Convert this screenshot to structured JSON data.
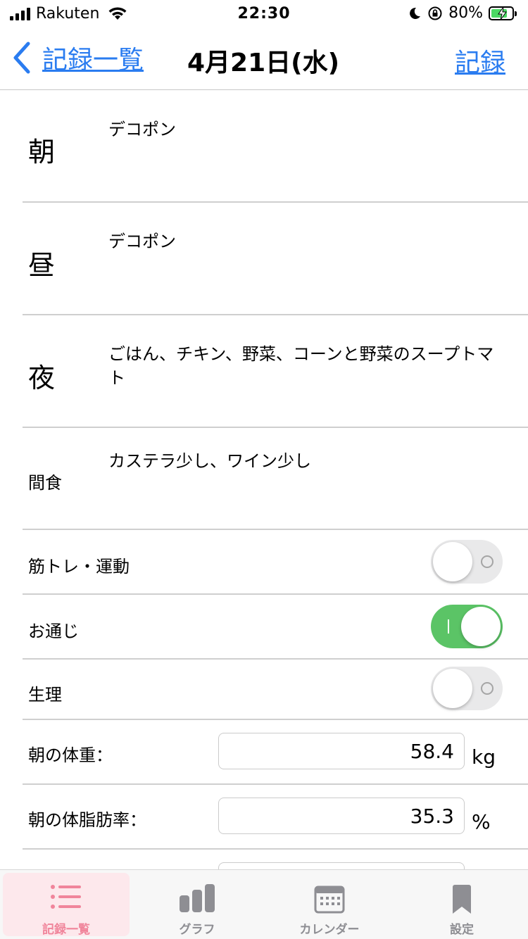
{
  "status_bar": {
    "carrier": "Rakuten",
    "time": "22:30",
    "battery": "80%",
    "battery_level": 0.8
  },
  "nav": {
    "back_label": "記録一覧",
    "title": "4月21日(水)",
    "action_label": "記録"
  },
  "meals": [
    {
      "label": "朝",
      "text": "デコポン"
    },
    {
      "label": "昼",
      "text": "デコポン"
    },
    {
      "label": "夜",
      "text": "ごはん、チキン、野菜、コーンと野菜のスープトマト"
    },
    {
      "label": "間食",
      "text": "カステラ少し、ワイン少し"
    }
  ],
  "toggles": [
    {
      "label": "筋トレ・運動",
      "on": false
    },
    {
      "label": "お通じ",
      "on": true
    },
    {
      "label": "生理",
      "on": false
    }
  ],
  "inputs": [
    {
      "label": "朝の体重：",
      "value": "58.4",
      "unit": "kg"
    },
    {
      "label": "朝の体脂肪率：",
      "value": "35.3",
      "unit": "%"
    }
  ],
  "tabs": [
    {
      "label": "記録一覧",
      "icon": "list-icon",
      "active": true
    },
    {
      "label": "グラフ",
      "icon": "bar-chart-icon",
      "active": false
    },
    {
      "label": "カレンダー",
      "icon": "calendar-icon",
      "active": false
    },
    {
      "label": "設定",
      "icon": "bookmark-icon",
      "active": false
    }
  ],
  "colors": {
    "accent_blue": "#2a7cf0",
    "toggle_on": "#5bc466",
    "tab_active": "#f0859b"
  }
}
